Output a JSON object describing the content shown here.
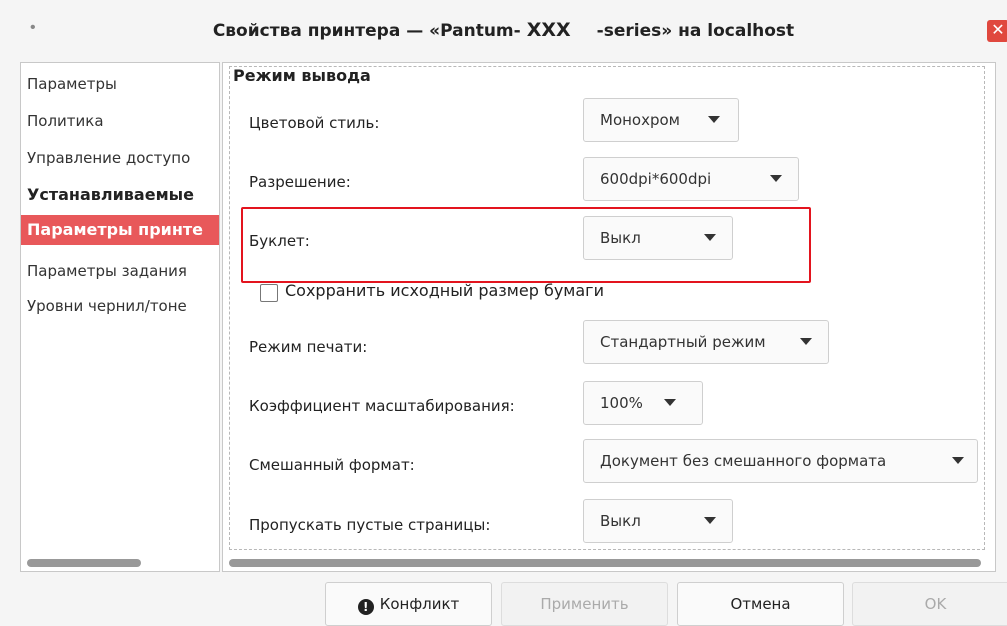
{
  "window": {
    "title_left": "Свойства принтера — «Pantum-",
    "title_model": "XXX",
    "title_right": "-series» на localhost",
    "close_glyph": "✕"
  },
  "sidebar": {
    "items": [
      {
        "label": "Параметры"
      },
      {
        "label": "Политика"
      },
      {
        "label": "Управление доступо"
      },
      {
        "label": "Устанавливаемые"
      },
      {
        "label": "Параметры принте"
      },
      {
        "label": "Параметры задания"
      },
      {
        "label": "Уровни чернил/тоне"
      }
    ]
  },
  "panel": {
    "section_title": "Режим вывода",
    "rows": [
      {
        "label": "Цветовой стиль:",
        "value": "Монохром"
      },
      {
        "label": "Разрешение:",
        "value": "600dpi*600dpi"
      },
      {
        "label": "Буклет:",
        "value": "Выкл"
      },
      {
        "label": "Режим печати:",
        "value": "Стандартный режим"
      },
      {
        "label": "Коэффициент масштабирования:",
        "value": "100%"
      },
      {
        "label": "Смешанный формат:",
        "value": "Документ без смешанного формата"
      },
      {
        "label": "Пропускать пустые страницы:",
        "value": "Выкл"
      }
    ],
    "checkbox": {
      "label": "Сохрранить исходный размер бумаги",
      "checked": false
    }
  },
  "buttons": {
    "conflict": "Конфликт",
    "apply": "Применить",
    "cancel": "Отмена",
    "ok": "OK"
  },
  "colors": {
    "accent": "#e8585a",
    "highlight": "#e3141e"
  }
}
